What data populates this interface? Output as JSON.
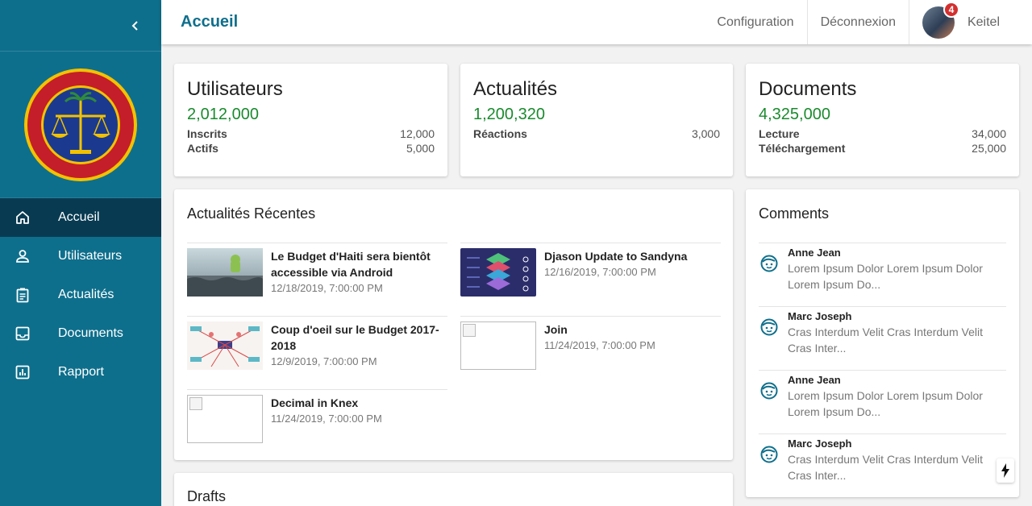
{
  "header": {
    "title": "Accueil",
    "links": [
      "Configuration",
      "Déconnexion"
    ],
    "user": {
      "name": "Keitel",
      "notifications": "4"
    }
  },
  "sidebar": {
    "items": [
      {
        "label": "Accueil",
        "icon": "home-icon",
        "active": true
      },
      {
        "label": "Utilisateurs",
        "icon": "person-icon"
      },
      {
        "label": "Actualités",
        "icon": "clipboard-icon"
      },
      {
        "label": "Documents",
        "icon": "inbox-icon"
      },
      {
        "label": "Rapport",
        "icon": "bar-chart-icon"
      }
    ]
  },
  "stats": [
    {
      "title": "Utilisateurs",
      "value": "2,012,000",
      "rows": [
        {
          "label": "Inscrits",
          "value": "12,000"
        },
        {
          "label": "Actifs",
          "value": "5,000"
        }
      ]
    },
    {
      "title": "Actualités",
      "value": "1,200,320",
      "rows": [
        {
          "label": "Réactions",
          "value": "3,000"
        }
      ]
    },
    {
      "title": "Documents",
      "value": "4,325,000",
      "rows": [
        {
          "label": "Lecture",
          "value": "34,000"
        },
        {
          "label": "Téléchargement",
          "value": "25,000"
        }
      ]
    }
  ],
  "recent_news": {
    "title": "Actualités Récentes",
    "items": [
      {
        "title": "Le Budget d'Haiti sera bientôt accessible via Android",
        "date": "12/18/2019, 7:00:00 PM"
      },
      {
        "title": "Djason Update to Sandyna",
        "date": "12/16/2019, 7:00:00 PM"
      },
      {
        "title": "Coup d'oeil sur le Budget 2017-2018",
        "date": "12/9/2019, 7:00:00 PM"
      },
      {
        "title": "Join",
        "date": "11/24/2019, 7:00:00 PM"
      },
      {
        "title": "Decimal in Knex",
        "date": "11/24/2019, 7:00:00 PM"
      }
    ]
  },
  "comments": {
    "title": "Comments",
    "items": [
      {
        "author": "Anne Jean",
        "text": "Lorem Ipsum Dolor Lorem Ipsum Dolor Lorem Ipsum Do..."
      },
      {
        "author": "Marc Joseph",
        "text": "Cras Interdum Velit Cras Interdum Velit Cras Inter..."
      },
      {
        "author": "Anne Jean",
        "text": "Lorem Ipsum Dolor Lorem Ipsum Dolor Lorem Ipsum Do..."
      },
      {
        "author": "Marc Joseph",
        "text": "Cras Interdum Velit Cras Interdum Velit Cras Inter..."
      }
    ]
  },
  "drafts": {
    "title": "Drafts"
  },
  "colors": {
    "primary": "#0e6f8c",
    "active_nav": "#083b52",
    "positive": "#1a8a2e",
    "badge": "#d32f2f"
  }
}
